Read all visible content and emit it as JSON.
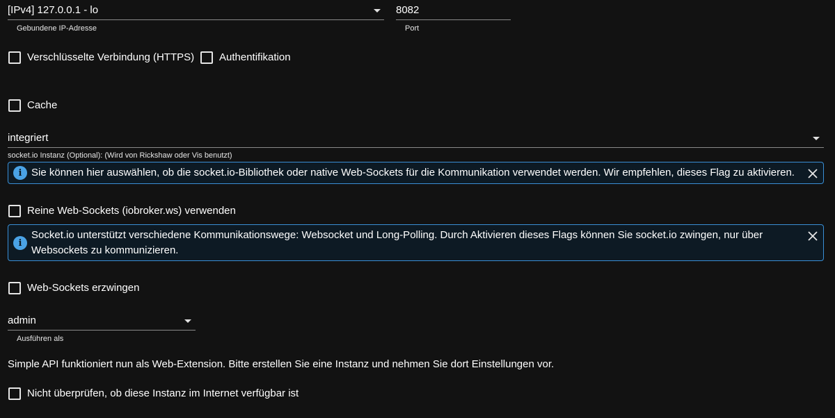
{
  "bind_ip": {
    "value": "[IPv4] 127.0.0.1 - lo",
    "helper": "Gebundene IP-Adresse"
  },
  "port": {
    "value": "8082",
    "helper": "Port"
  },
  "checkboxes": {
    "https": {
      "label": "Verschlüsselte Verbindung (HTTPS)",
      "checked": false
    },
    "auth": {
      "label": "Authentifikation",
      "checked": false
    },
    "cache": {
      "label": "Cache",
      "checked": false
    },
    "pure_ws": {
      "label": "Reine Web-Sockets (iobroker.ws) verwenden",
      "checked": false
    },
    "force_ws": {
      "label": "Web-Sockets erzwingen",
      "checked": false
    },
    "no_check": {
      "label": "Nicht überprüfen, ob diese Instanz im Internet verfügbar ist",
      "checked": false
    }
  },
  "socketio": {
    "value": "integriert",
    "helper": "socket.io Instanz (Optional): (Wird von Rickshaw oder Vis benutzt)"
  },
  "alerts": {
    "socketio_info": "Sie können hier auswählen, ob die socket.io-Bibliothek oder native Web-Sockets für die Kommunikation verwendet werden. Wir empfehlen, dieses Flag zu aktivieren.",
    "websocket_info": "Socket.io unterstützt verschiedene Kommunikationswege: Websocket und Long-Polling. Durch Aktivieren dieses Flags können Sie socket.io zwingen, nur über Websockets zu kommunizieren."
  },
  "run_as": {
    "value": "admin",
    "helper": "Ausführen als"
  },
  "simple_api_note": "Simple API funktioniert nun als Web-Extension. Bitte erstellen Sie eine Instanz und nehmen Sie dort Einstellungen vor.",
  "colors": {
    "background": "#121212",
    "alert_border": "#3a8fd6",
    "info_icon": "#4aa3e6"
  }
}
